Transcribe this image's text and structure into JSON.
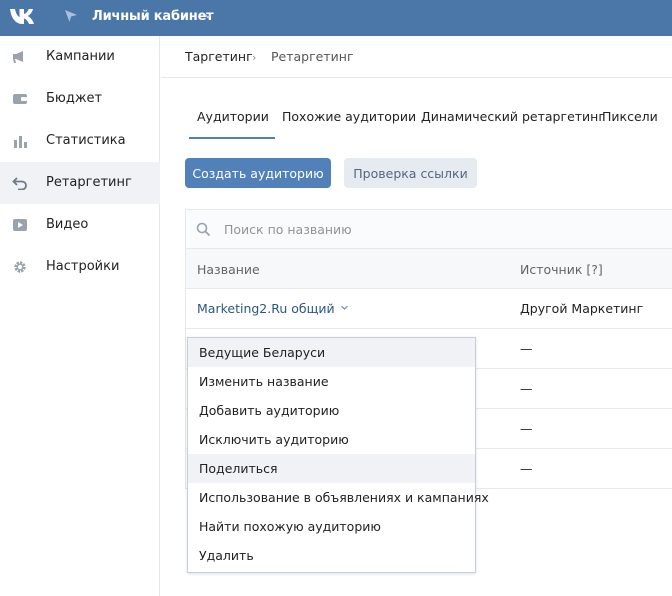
{
  "header": {
    "title": "Личный кабинет",
    "logo": "vk-logo-icon"
  },
  "sidebar": {
    "items": [
      {
        "label": "Кампании",
        "icon": "megaphone-icon",
        "active": false
      },
      {
        "label": "Бюджет",
        "icon": "wallet-icon",
        "active": false
      },
      {
        "label": "Статистика",
        "icon": "bar-chart-icon",
        "active": false
      },
      {
        "label": "Ретаргетинг",
        "icon": "return-arrow-icon",
        "active": true
      },
      {
        "label": "Видео",
        "icon": "play-icon",
        "active": false
      },
      {
        "label": "Настройки",
        "icon": "gear-icon",
        "active": false
      }
    ]
  },
  "breadcrumb": {
    "parent": "Таргетинг",
    "separator": "›",
    "current": "Ретаргетинг"
  },
  "tabs": [
    {
      "label": "Аудитории",
      "active": true
    },
    {
      "label": "Похожие аудитории",
      "active": false
    },
    {
      "label": "Динамический ретаргетинг",
      "active": false
    },
    {
      "label": "Пиксели",
      "active": false
    }
  ],
  "buttons": {
    "create": "Создать аудиторию",
    "check": "Проверка ссылки"
  },
  "search": {
    "placeholder": "Поиск по названию",
    "value": ""
  },
  "table": {
    "headers": {
      "name": "Название",
      "source": "Источник [?]"
    },
    "rows": [
      {
        "name": "Marketing2.Ru общий",
        "source": "Другой Маркетинг"
      },
      {
        "name": "",
        "source": "—"
      },
      {
        "name": "",
        "source": "—"
      },
      {
        "name": "",
        "source": "—"
      },
      {
        "name": "",
        "source": "—"
      }
    ]
  },
  "menu": {
    "items": [
      {
        "label": "Ведущие Беларуси",
        "highlighted": true
      },
      {
        "label": "Изменить название",
        "highlighted": false
      },
      {
        "label": "Добавить аудиторию",
        "highlighted": false
      },
      {
        "label": "Исключить аудиторию",
        "highlighted": false
      },
      {
        "label": "Поделиться",
        "highlighted": true
      },
      {
        "label": "Использование в объявлениях и кампаниях",
        "highlighted": false
      },
      {
        "label": "Найти похожую аудиторию",
        "highlighted": false
      },
      {
        "label": "Удалить",
        "highlighted": false
      }
    ]
  },
  "colors": {
    "brand": "#4a76a8",
    "accent": "#5181b8",
    "link": "#2a5885"
  }
}
